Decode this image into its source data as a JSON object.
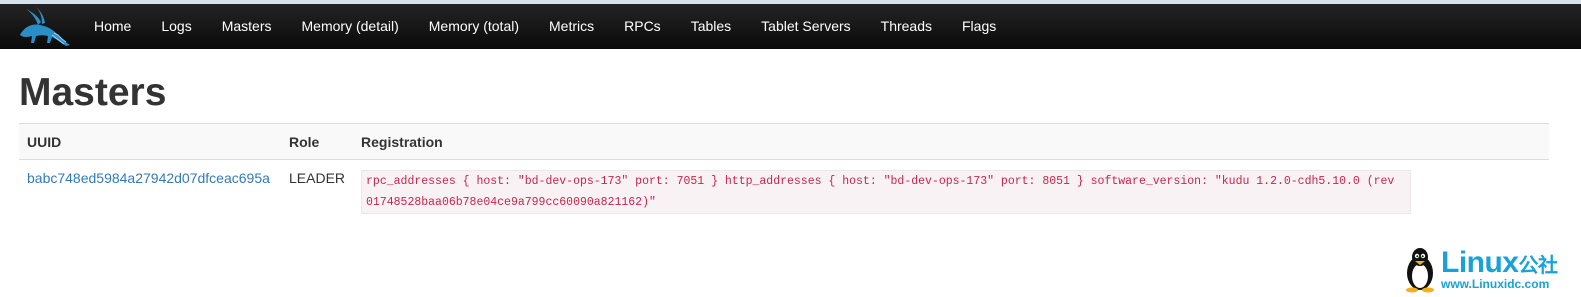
{
  "nav": {
    "items": [
      {
        "label": "Home"
      },
      {
        "label": "Logs"
      },
      {
        "label": "Masters"
      },
      {
        "label": "Memory (detail)"
      },
      {
        "label": "Memory (total)"
      },
      {
        "label": "Metrics"
      },
      {
        "label": "RPCs"
      },
      {
        "label": "Tables"
      },
      {
        "label": "Tablet Servers"
      },
      {
        "label": "Threads"
      },
      {
        "label": "Flags"
      }
    ]
  },
  "page": {
    "title": "Masters"
  },
  "table": {
    "headers": [
      "UUID",
      "Role",
      "Registration"
    ],
    "rows": [
      {
        "uuid": "babc748ed5984a27942d07dfceac695a",
        "role": "LEADER",
        "registration": "rpc_addresses { host: \"bd-dev-ops-173\" port: 7051 } http_addresses { host: \"bd-dev-ops-173\" port: 8051 } software_version: \"kudu 1.2.0-cdh5.10.0 (rev 01748528baa06b78e04ce9a799cc60090a821162)\""
      }
    ]
  },
  "watermark": {
    "brand": "Linux",
    "cn": "公社",
    "url": "www.Linuxidc.com"
  },
  "colors": {
    "navbar": "#111111",
    "link": "#337ab7",
    "code": "#c7254e",
    "watermark": "#1aa1d8"
  },
  "icons": {
    "logo": "kudu-antelope-logo",
    "watermark_mascot": "tux-penguin-icon"
  }
}
